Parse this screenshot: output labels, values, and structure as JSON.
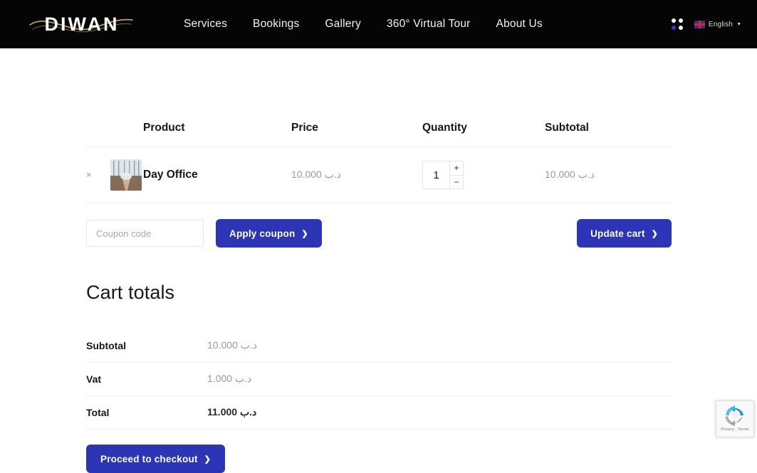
{
  "header": {
    "logo_text": "DIWAN",
    "nav": [
      {
        "label": "Services"
      },
      {
        "label": "Bookings"
      },
      {
        "label": "Gallery"
      },
      {
        "label": "360° Virtual Tour"
      },
      {
        "label": "About Us"
      }
    ],
    "apps_icon": "grid-dots-icon",
    "language": {
      "flag": "uk-flag-icon",
      "label": "English",
      "caret": "▼"
    }
  },
  "cart": {
    "columns": {
      "product": "Product",
      "price": "Price",
      "quantity": "Quantity",
      "subtotal": "Subtotal"
    },
    "items": [
      {
        "remove_label": "×",
        "name": "Day Office",
        "price": "د.ب 10.000",
        "quantity": "1",
        "qty_increase": "+",
        "qty_decrease": "−",
        "subtotal": "د.ب 10.000"
      }
    ],
    "coupon": {
      "placeholder": "Coupon code",
      "value": "",
      "apply_label": "Apply coupon",
      "chevron": "❯"
    },
    "update_label": "Update cart",
    "update_chevron": "❯"
  },
  "totals": {
    "title": "Cart totals",
    "rows": [
      {
        "label": "Subtotal",
        "value": "د.ب 10.000"
      },
      {
        "label": "Vat",
        "value": "1.000 د.ب"
      },
      {
        "label": "Total",
        "value": "د.ب 11.000"
      }
    ],
    "checkout_label": "Proceed to checkout",
    "checkout_chevron": "❯"
  },
  "recaptcha": {
    "text": "Privacy - Terms"
  },
  "colors": {
    "accent_blue": "#2b35b5",
    "header_bg": "#050505",
    "logo_swoosh": "#c8b15a",
    "divider": "#eceef0",
    "muted_text": "#9a9a9e"
  }
}
